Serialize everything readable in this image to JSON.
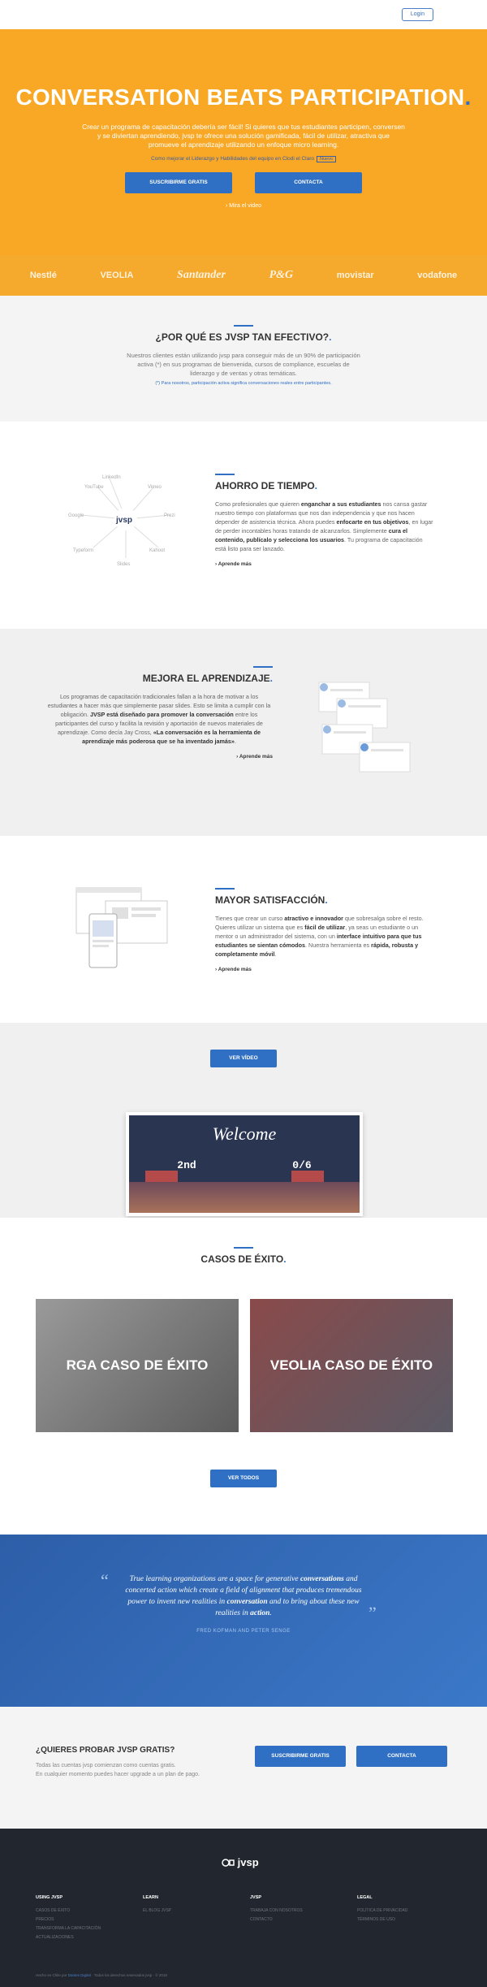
{
  "topbar": {
    "login": "Login"
  },
  "hero": {
    "title": "CONVERSATION BEATS PARTICIPATION",
    "title_dot": ".",
    "subtitle": "Crear un programa de capacitación debería ser fácil! Si quieres que tus estudiantes participen, conversen y se diviertan aprendiendo, jvsp te ofrece una solución gamificada, fácil de utilizar, atractiva que promueve el aprendizaje utilizando un enfoque micro learning.",
    "small": "Como mejorar el Liderazgo y Habilidades del equipo en Clodi el Claro",
    "small_tag": "Nuevo",
    "btn_subscribe": "SUSCRIBIRME GRATIS",
    "btn_contact": "CONTACTA",
    "video_link": "› Mira el video"
  },
  "logos": [
    "Nestlé",
    "VEOLIA",
    "Santander",
    "P&G",
    "movistar",
    "vodafone"
  ],
  "why": {
    "title": "¿POR QUÉ ES JVSP TAN EFECTIVO?",
    "dot": ".",
    "body": "Nuestros clientes están utilizando jvsp para conseguir más de un 90% de participación activa (*) en sus programas de bienvenida, cursos de compliance, escuelas de liderazgo y de ventas y otras temáticas.",
    "note": "(*) Para nosotros, participación activa significa conversaciones reales entre participantes."
  },
  "s1": {
    "title": "AHORRO DE TIEMPO",
    "dot": ".",
    "p1": "Como profesionales que quieren ",
    "b1": "enganchar a sus estudiantes",
    "p2": " nos cansa gastar nuestro tiempo con plataformas que nos dan independencia y que nos hacen depender de asistencia técnica. Ahora puedes ",
    "b2": "enfocarte en tus objetivos",
    "p3": ", en lugar de perder incontables horas tratando de alcanzarlos. Simplemente ",
    "b3": "cura el contenido, publícalo y selecciona los usuarios",
    "p4": ". Tu programa de capacitación está listo para ser lanzado.",
    "more": "Aprende más",
    "hub": "jvsp",
    "nodes": [
      "YouTube",
      "Vimeo",
      "Google",
      "Prezi",
      "Typeform",
      "Kahoot",
      "LinkedIn",
      "Slides"
    ]
  },
  "s2": {
    "title": "MEJORA EL APRENDIZAJE",
    "dot": ".",
    "p1": "Los programas de capacitación tradicionales fallan a la hora de motivar a los estudiantes a hacer más que simplemente pasar slides. Esto se limita a cumplir con la obligación. ",
    "b1": "JVSP está diseñado para promover la conversación",
    "p2": " entre los participantes del curso y facilita la revisión y aportación de nuevos materiales de aprendizaje. Como decía Jay Cross, ",
    "b2": "«La conversación es la herramienta de aprendizaje más poderosa que se ha inventado jamás»",
    "p3": ".",
    "more": "Aprende más"
  },
  "s3": {
    "title": "MAYOR SATISFACCIÓN",
    "dot": ".",
    "p1": "Tienes que crear un curso ",
    "b1": "atractivo e innovador",
    "p2": " que sobresalga sobre el resto. Quieres utilizar un sistema que es ",
    "b2": "fácil de utilizar",
    "p3": ", ya seas un estudiante o un mentor o un administrador del sistema, con un ",
    "b3": "interface intuitivo para que tus estudiantes se sientan cómodos",
    "p4": ". Nuestra herramienta es ",
    "b4": "rápida, robusta y completamente móvil",
    "p5": ".",
    "more": "Aprende más"
  },
  "video": {
    "btn": "VER VÍDEO",
    "welcome": "Welcome",
    "row": [
      "2nd",
      "0/6"
    ]
  },
  "cases": {
    "title": "CASOS DE ÉXITO",
    "dot": ".",
    "rga": "RGA CASO DE ÉXITO",
    "veolia": "VEOLIA CASO DE ÉXITO",
    "see_all": "VER TODOS"
  },
  "quote": {
    "q1": "True learning organizations are a space for generative ",
    "b1": "conversations",
    "q2": " and concerted action which create a field of alignment that produces tremendous power to invent new realities in ",
    "b2": "conversation",
    "q3": " and to bring about these new realities in ",
    "b3": "action",
    "q4": ".",
    "author": "FRED KOFMAN AND PETER SENGE"
  },
  "try": {
    "title": "¿QUIERES PROBAR JVSP GRATIS?",
    "line1": "Todas las cuentas jvsp comienzan como cuentas gratis.",
    "line2": "En cualquier momento puedes hacer upgrade a un plan de pago.",
    "btn_subscribe": "SUSCRIBIRME GRATIS",
    "btn_contact": "CONTACTA"
  },
  "footer": {
    "logo": "jvsp",
    "cols": [
      {
        "title": "USING JVSP",
        "items": [
          "CASOS DE ÉXITO",
          "PRECIOS",
          "TRANSFORMA LA CAPACITACIÓN",
          "ACTUALIZACIONES"
        ]
      },
      {
        "title": "LEARN",
        "items": [
          "EL BLOG JVSP"
        ]
      },
      {
        "title": "JVSP",
        "items": [
          "TRABAJA CON NOSOTROS",
          "CONTACTO"
        ]
      },
      {
        "title": "LEGAL",
        "items": [
          "POLÍTICA DE PRIVACIDAD",
          "TÉRMINOS DE USO"
        ]
      }
    ],
    "copy_pre": "Hecho en Chile por ",
    "copy_link": "Dantes Digital",
    "copy_post": " · Todos los derechos reservados jvsp · © 2018"
  }
}
